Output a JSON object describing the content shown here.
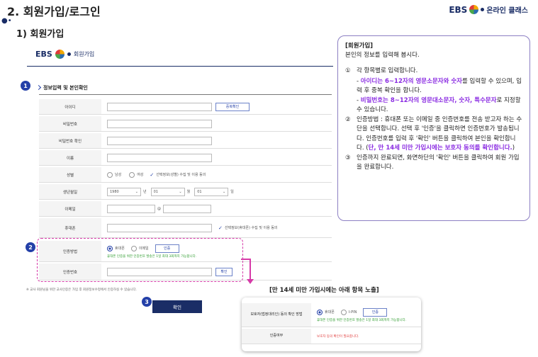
{
  "header": {
    "title": "2. 회원가입/로그인",
    "brand": "EBS",
    "brand_sub": "온라인 클래스"
  },
  "section": {
    "subtitle": "1) 회원가입"
  },
  "form": {
    "brand": "EBS",
    "brand_label": "회원가입",
    "section_label": "정보입력 및 본인확인",
    "steps": [
      "1",
      "2",
      "3"
    ],
    "labels": {
      "id": "아이디",
      "pw": "비밀번호",
      "pw2": "비밀번호 확인",
      "name": "이름",
      "gender": "성별",
      "birth": "생년월일",
      "email": "이메일",
      "phone": "휴대폰",
      "auth_method": "인증방법",
      "auth_no": "인증번호"
    },
    "dup_button": "중복확인",
    "gender": {
      "male": "남성",
      "female": "여성",
      "consent": "선택정보(성별) 수집 및 이용 동의"
    },
    "birth": {
      "year": "1980",
      "year_unit": "년",
      "month": "01",
      "month_unit": "월",
      "day": "01",
      "day_unit": "일"
    },
    "email_at": "@",
    "phone_consent": "선택정보(휴대폰) 수집 및 이용 동의",
    "auth": {
      "phone": "휴대폰",
      "email": "이메일",
      "button": "인증",
      "note": "휴대폰 인증을 위한 인증번호 발송은 1일 최대 3회까지 가능합니다."
    },
    "confirm_small": "확인",
    "footnote": "※ 교사 회원님을 위한 교사인증은 가입 후 회원정보수정에서 인증하실 수 있습니다.",
    "submit": "확인"
  },
  "panel": {
    "heading": "[회원가입]",
    "intro": "본인의 정보를 입력해 봅시다.",
    "items": [
      {
        "n": "①",
        "text": "각 항목별로 입력합니다."
      },
      {
        "n": "",
        "pre": "- ",
        "hl": "아이디는 6~12자의 영문소문자와 숫자",
        "post": "를 입력할 수 있으며, 입력 후 중복 확인을 합니다."
      },
      {
        "n": "",
        "pre": "- ",
        "hl": "비밀번호는 8~12자의 영문대소문자, 숫자, 특수문자",
        "post": "로 지정할 수 있습니다."
      },
      {
        "n": "②",
        "pre": "인증방법 : 휴대폰 또는 이메일 중 인증번호를 전송 받고자 하는 수단을 선택합니다. 선택 후 '인증'을 클릭하면 인증번호가 발송됩니다. 인증번호를 입력 후 '확인' 버튼을 클릭하여 본인을 확인합니다. (",
        "hl": "단, 만 14세 미만 가입시에는 보호자 동의를 확인합니다.",
        "post": ")"
      },
      {
        "n": "③",
        "text": "인증까지 완료되면, 화면하단의 '확인' 버튼을 클릭하여 회원 가입을 완료합니다."
      }
    ]
  },
  "minor": {
    "title": "[만 14세 미만 가입시에는 아래 항목 노출]",
    "guardian_label": "보호자(법정대리인) 동의 확인 방법",
    "phone": "휴대폰",
    "ipin": "I-PIN",
    "button": "인증",
    "note": "휴대폰 인증을 위한 인증번호 발송은 1일 최대 3회까지 가능합니다.",
    "consent_label": "인증여부",
    "consent_status": "보호자 동의 확인이 필요합니다."
  }
}
